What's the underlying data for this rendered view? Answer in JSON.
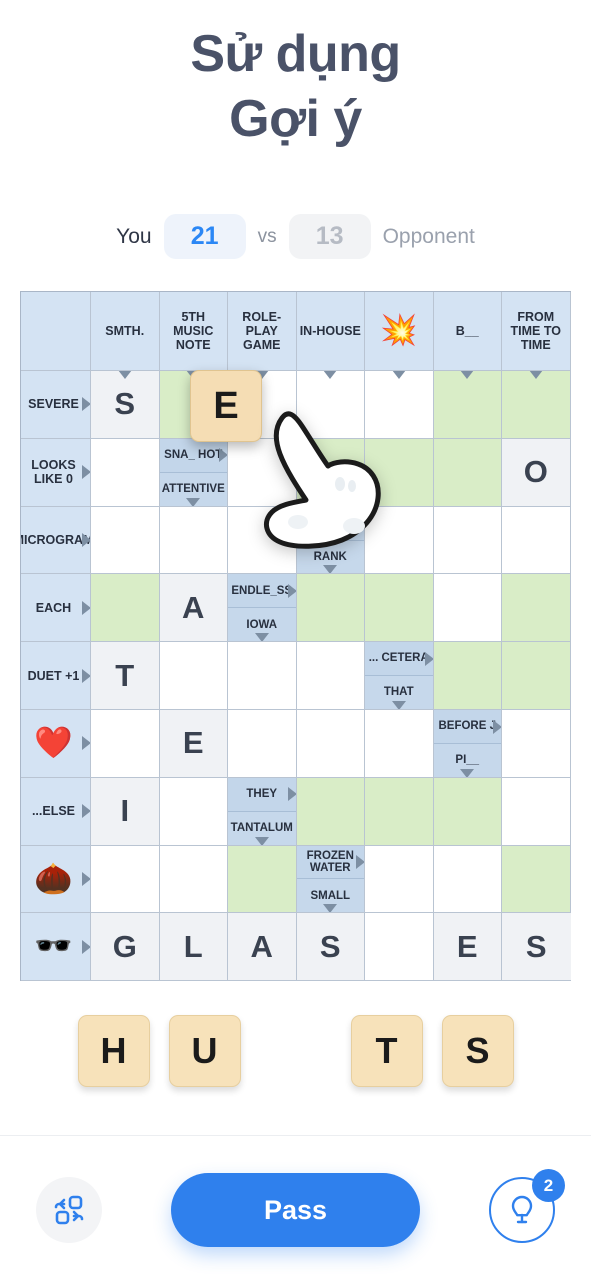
{
  "header": {
    "title_line1": "Sử dụng",
    "title_line2": "Gợi ý"
  },
  "score": {
    "you_label": "You",
    "you_value": "21",
    "vs_label": "vs",
    "opponent_value": "13",
    "opponent_label": "Opponent",
    "you_color": "#2b87f5",
    "opponent_color": "#b6bbc4"
  },
  "grid": {
    "corner": "",
    "column_headers": [
      "SMTH.",
      "5TH MUSIC NOTE",
      "ROLE-PLAY GAME",
      "IN-HOUSE",
      "💥",
      "B__",
      "FROM TIME TO TIME"
    ],
    "row_headers": [
      "SEVERE",
      "LOOKS LIKE 0",
      "MICROGRAM",
      "EACH",
      "DUET +1",
      "❤️",
      "...ELSE",
      "🌰",
      "🕶️"
    ],
    "cells": [
      [
        {
          "type": "letter",
          "text": "S"
        },
        {
          "type": "green"
        },
        {
          "type": "white"
        },
        {
          "type": "white"
        },
        {
          "type": "white"
        },
        {
          "type": "green"
        },
        {
          "type": "green"
        }
      ],
      [
        {
          "type": "white"
        },
        {
          "type": "clue",
          "across": "SNA_ HOT",
          "down": "ATTENTIVE"
        },
        {
          "type": "white"
        },
        {
          "type": "green"
        },
        {
          "type": "green"
        },
        {
          "type": "green"
        },
        {
          "type": "letter",
          "text": "O"
        }
      ],
      [
        {
          "type": "white"
        },
        {
          "type": "white"
        },
        {
          "type": "white"
        },
        {
          "type": "clue",
          "across": "__",
          "down": "RANK"
        },
        {
          "type": "white"
        },
        {
          "type": "white"
        },
        {
          "type": "white"
        }
      ],
      [
        {
          "type": "green"
        },
        {
          "type": "letter",
          "text": "A"
        },
        {
          "type": "clue",
          "across": "ENDLE_SS",
          "down": "IOWA"
        },
        {
          "type": "green"
        },
        {
          "type": "green"
        },
        {
          "type": "white"
        },
        {
          "type": "green"
        }
      ],
      [
        {
          "type": "letter",
          "text": "T"
        },
        {
          "type": "white"
        },
        {
          "type": "white"
        },
        {
          "type": "white"
        },
        {
          "type": "clue",
          "across": "... CETERA",
          "down": "THAT"
        },
        {
          "type": "green"
        },
        {
          "type": "green"
        }
      ],
      [
        {
          "type": "white"
        },
        {
          "type": "letter",
          "text": "E"
        },
        {
          "type": "white"
        },
        {
          "type": "white"
        },
        {
          "type": "white"
        },
        {
          "type": "clue",
          "across": "BEFORE J",
          "down": "PI__"
        },
        {
          "type": "white"
        }
      ],
      [
        {
          "type": "letter",
          "text": "I"
        },
        {
          "type": "white"
        },
        {
          "type": "clue",
          "across": "THEY",
          "down": "TANTALUM"
        },
        {
          "type": "green"
        },
        {
          "type": "green"
        },
        {
          "type": "green"
        },
        {
          "type": "white"
        }
      ],
      [
        {
          "type": "white"
        },
        {
          "type": "white"
        },
        {
          "type": "green"
        },
        {
          "type": "clue",
          "across": "FROZEN WATER",
          "down": "SMALL"
        },
        {
          "type": "white"
        },
        {
          "type": "white"
        },
        {
          "type": "green"
        }
      ],
      [
        {
          "type": "letter",
          "text": "G"
        },
        {
          "type": "letter",
          "text": "L"
        },
        {
          "type": "letter",
          "text": "A"
        },
        {
          "type": "letter",
          "text": "S"
        },
        {
          "type": "white"
        },
        {
          "type": "letter",
          "text": "E"
        },
        {
          "type": "letter",
          "text": "S"
        }
      ]
    ]
  },
  "drag": {
    "tile_letter": "E"
  },
  "rack": {
    "tiles": [
      "H",
      "U",
      "",
      "T",
      "S"
    ]
  },
  "bottom": {
    "shuffle_icon": "shuffle-icon",
    "pass_label": "Pass",
    "hint_icon": "lightbulb-icon",
    "hint_count": "2"
  }
}
